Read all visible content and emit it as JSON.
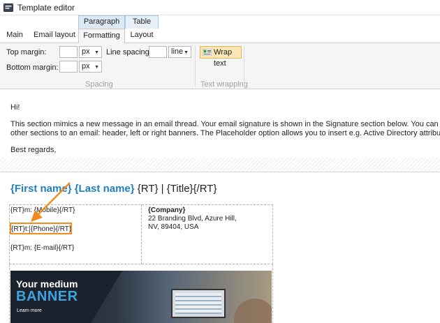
{
  "window": {
    "title": "Template editor"
  },
  "context_tabs": [
    {
      "label": "Paragraph"
    },
    {
      "label": "Table"
    }
  ],
  "ribbon_tabs": [
    {
      "label": "Main"
    },
    {
      "label": "Email layout"
    },
    {
      "label": "Formatting",
      "active": true
    },
    {
      "label": "Layout"
    }
  ],
  "ribbon": {
    "top_margin_label": "Top margin:",
    "top_margin_value": "",
    "top_margin_unit": "px",
    "bottom_margin_label": "Bottom margin:",
    "bottom_margin_value": "",
    "bottom_margin_unit": "px",
    "line_spacing_label": "Line spacing",
    "line_spacing_value": "",
    "line_spacing_unit": "line",
    "spacing_group": "Spacing",
    "wrap_text_label": "Wrap text",
    "text_wrapping_group": "Text wrapping"
  },
  "message": {
    "greeting": "Hi!",
    "line1": "This section mimics a new message in an email thread. Your email signature is shown in the Signature section below. You can use the E",
    "line2": "other sections to an email: header, left or right banners. The Placeholder option allows you to insert e.g. Active Directory attributes (such",
    "closing": "Best regards,"
  },
  "signature": {
    "first_name": "{First name}",
    "last_name": "{Last name}",
    "title_part": "{RT} | {Title}{/RT}",
    "mobile": "{RT}m: {Mobile}{/RT}",
    "phone_prefix": "{RT}t:",
    "phone_value": "{Phone}{/RT}",
    "email": "{RT}m: {E-mail}{/RT}",
    "company": "{Company}",
    "address1": "22 Branding Blvd, Azure Hill,",
    "address2": "NV, 89404, USA"
  },
  "banner": {
    "line1": "Your medium",
    "line2": "BANNER",
    "line3": "Learn more"
  },
  "colors": {
    "accent_blue": "#1f7fc4",
    "highlight_orange": "#f28c1e",
    "wrap_button_bg": "#fde6b6"
  }
}
